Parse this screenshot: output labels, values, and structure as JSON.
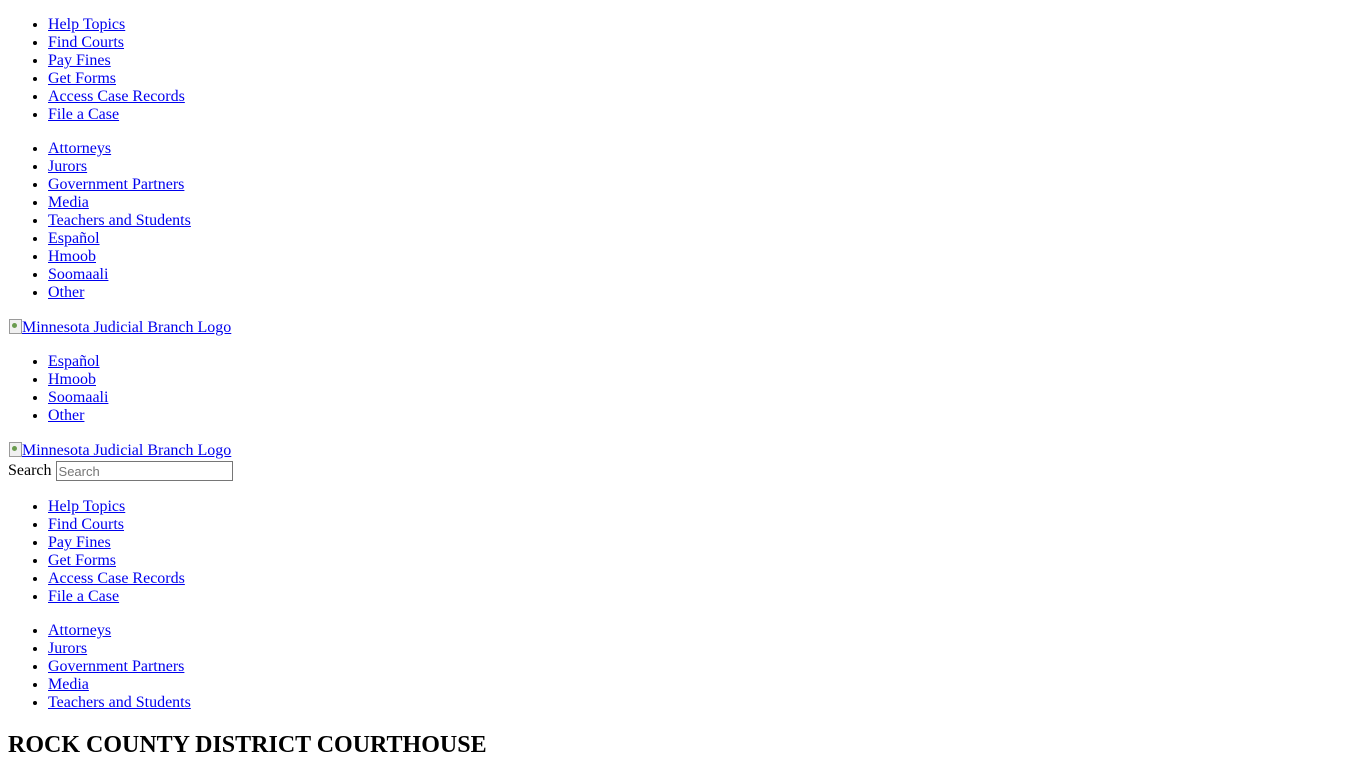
{
  "primary_nav_top": {
    "items": [
      {
        "label": "Help Topics"
      },
      {
        "label": "Find Courts"
      },
      {
        "label": "Pay Fines"
      },
      {
        "label": "Get Forms"
      },
      {
        "label": "Access Case Records"
      },
      {
        "label": "File a Case"
      }
    ]
  },
  "audience_nav_top": {
    "items": [
      {
        "label": "Attorneys"
      },
      {
        "label": "Jurors"
      },
      {
        "label": "Government Partners"
      },
      {
        "label": "Media"
      },
      {
        "label": "Teachers and Students"
      },
      {
        "label": "Español"
      },
      {
        "label": "Hmoob"
      },
      {
        "label": "Soomaali"
      },
      {
        "label": "Other"
      }
    ]
  },
  "logo": {
    "alt": "Minnesota Judicial Branch Logo"
  },
  "language_nav": {
    "items": [
      {
        "label": "Español"
      },
      {
        "label": "Hmoob"
      },
      {
        "label": "Soomaali"
      },
      {
        "label": "Other"
      }
    ]
  },
  "search": {
    "label": "Search",
    "placeholder": "Search",
    "value": ""
  },
  "primary_nav_bottom": {
    "items": [
      {
        "label": "Help Topics"
      },
      {
        "label": "Find Courts"
      },
      {
        "label": "Pay Fines"
      },
      {
        "label": "Get Forms"
      },
      {
        "label": "Access Case Records"
      },
      {
        "label": "File a Case"
      }
    ]
  },
  "audience_nav_bottom": {
    "items": [
      {
        "label": "Attorneys"
      },
      {
        "label": "Jurors"
      },
      {
        "label": "Government Partners"
      },
      {
        "label": "Media"
      },
      {
        "label": "Teachers and Students"
      }
    ]
  },
  "page": {
    "heading": "ROCK COUNTY DISTRICT COURTHOUSE"
  },
  "colors": {
    "link": "#0000ee",
    "text": "#000000",
    "background": "#ffffff"
  }
}
